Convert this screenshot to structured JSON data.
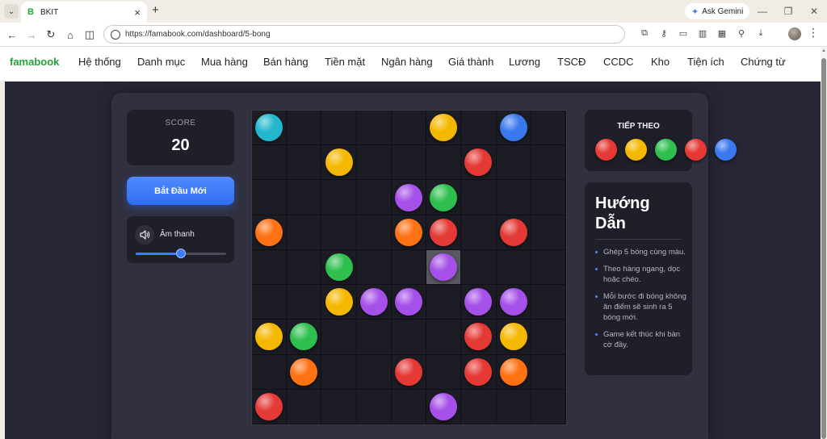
{
  "browser": {
    "tab": {
      "favicon": "B",
      "title": "BKIT",
      "close": "×"
    },
    "new_tab": "+",
    "gemini": {
      "icon": "✦",
      "label": "Ask Gemini"
    },
    "window_controls": [
      "—",
      "❐",
      "✕"
    ],
    "url": "https://famabook.com/dashboard/5-bong"
  },
  "site": {
    "brand": "famabook",
    "menu": [
      "Hệ thống",
      "Danh mục",
      "Mua hàng",
      "Bán hàng",
      "Tiền mặt",
      "Ngân hàng",
      "Giá thành",
      "Lương",
      "TSCĐ",
      "CCDC",
      "Kho",
      "Tiện ích",
      "Chứng từ"
    ]
  },
  "game": {
    "score_label": "SCORE",
    "score": "20",
    "new_game_label": "Bắt Đầu Mới",
    "sound_label": "Âm thanh",
    "volume": 0.5,
    "next_title": "TIẾP THEO",
    "next_balls": [
      "red",
      "yellow",
      "green",
      "red",
      "blue"
    ],
    "guide_title": "Hướng Dẫn",
    "guide_items": [
      "Ghép 5 bóng cùng màu.",
      "Theo hàng ngang, dọc hoặc chéo.",
      "Mỗi bước đi bóng không ăn điểm sẽ sinh ra 5 bóng mới.",
      "Game kết thúc khi bàn cờ đầy."
    ],
    "selected_cell": [
      4,
      5
    ],
    "board": [
      [
        "cyan",
        null,
        null,
        null,
        null,
        "yellow",
        null,
        "blue",
        null
      ],
      [
        null,
        null,
        "yellow",
        null,
        null,
        null,
        "red",
        null,
        null
      ],
      [
        null,
        null,
        null,
        null,
        "purple",
        "green",
        null,
        null,
        null
      ],
      [
        "orange",
        null,
        null,
        null,
        "orange",
        "red",
        null,
        "red",
        null
      ],
      [
        null,
        null,
        "green",
        null,
        null,
        "purple",
        null,
        null,
        null
      ],
      [
        null,
        null,
        "yellow",
        "purple",
        "purple",
        null,
        "purple",
        "purple",
        null
      ],
      [
        "yellow",
        "green",
        null,
        null,
        null,
        null,
        "red",
        "yellow",
        null
      ],
      [
        null,
        "orange",
        null,
        null,
        "red",
        null,
        "red",
        "orange",
        null
      ],
      [
        "red",
        null,
        null,
        null,
        null,
        "purple",
        null,
        null,
        null
      ]
    ]
  },
  "colors": {
    "red": "#e53935",
    "yellow": "#f5b800",
    "green": "#2fbf4f",
    "blue": "#3a78ee",
    "cyan": "#22b7cc",
    "orange": "#ff7214",
    "purple": "#a550e8"
  }
}
